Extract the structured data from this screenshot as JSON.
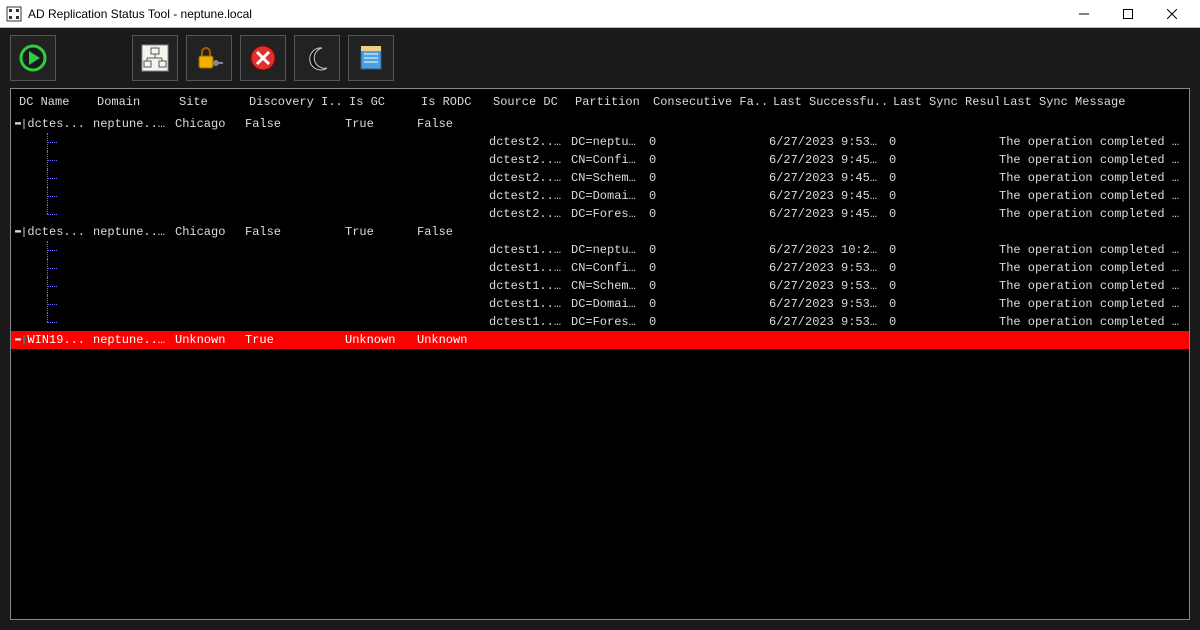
{
  "window": {
    "title": "AD Replication Status Tool - neptune.local",
    "minimize_icon": "minimize",
    "maximize_icon": "maximize",
    "close_icon": "close"
  },
  "toolbar": {
    "refresh_label": "Refresh",
    "forest_label": "Forest View",
    "auth_label": "Credentials",
    "errors_label": "Errors Only",
    "dark_label": "Dark Mode",
    "notes_label": "Notes"
  },
  "columns": {
    "dc_name": "DC Name",
    "domain": "Domain",
    "site": "Site",
    "discovery": "Discovery I...",
    "is_gc": "Is GC",
    "is_rodc": "Is RODC",
    "source_dc": "Source DC",
    "partition": "Partition",
    "consecutive_failures": "Consecutive Fa...",
    "last_success": "Last Successfu...",
    "last_sync_result": "Last Sync Result",
    "last_sync_message": "Last Sync Message"
  },
  "dcs": [
    {
      "dc_name": "dctes...",
      "domain": "neptune....",
      "site": "Chicago",
      "discovery": "False",
      "is_gc": "True",
      "is_rodc": "False",
      "partitions": [
        {
          "source": "dctest2....",
          "partition": "DC=neptu...",
          "failures": "0",
          "last_success": "6/27/2023 9:53:...",
          "result": "0",
          "message": "The operation completed succ..."
        },
        {
          "source": "dctest2....",
          "partition": "CN=Confi...",
          "failures": "0",
          "last_success": "6/27/2023 9:45:...",
          "result": "0",
          "message": "The operation completed succ..."
        },
        {
          "source": "dctest2....",
          "partition": "CN=Schem...",
          "failures": "0",
          "last_success": "6/27/2023 9:45:...",
          "result": "0",
          "message": "The operation completed succ..."
        },
        {
          "source": "dctest2....",
          "partition": "DC=Domai...",
          "failures": "0",
          "last_success": "6/27/2023 9:45:...",
          "result": "0",
          "message": "The operation completed succ..."
        },
        {
          "source": "dctest2....",
          "partition": "DC=Fores...",
          "failures": "0",
          "last_success": "6/27/2023 9:45:...",
          "result": "0",
          "message": "The operation completed succ..."
        }
      ]
    },
    {
      "dc_name": "dctes...",
      "domain": "neptune....",
      "site": "Chicago",
      "discovery": "False",
      "is_gc": "True",
      "is_rodc": "False",
      "partitions": [
        {
          "source": "dctest1....",
          "partition": "DC=neptu...",
          "failures": "0",
          "last_success": "6/27/2023 10:28...",
          "result": "0",
          "message": "The operation completed succ..."
        },
        {
          "source": "dctest1....",
          "partition": "CN=Confi...",
          "failures": "0",
          "last_success": "6/27/2023 9:53:...",
          "result": "0",
          "message": "The operation completed succ..."
        },
        {
          "source": "dctest1....",
          "partition": "CN=Schem...",
          "failures": "0",
          "last_success": "6/27/2023 9:53:...",
          "result": "0",
          "message": "The operation completed succ..."
        },
        {
          "source": "dctest1....",
          "partition": "DC=Domai...",
          "failures": "0",
          "last_success": "6/27/2023 9:53:...",
          "result": "0",
          "message": "The operation completed succ..."
        },
        {
          "source": "dctest1....",
          "partition": "DC=Fores...",
          "failures": "0",
          "last_success": "6/27/2023 9:53:...",
          "result": "0",
          "message": "The operation completed succ..."
        }
      ]
    }
  ],
  "error_dc": {
    "dc_name": "WIN19...",
    "domain": "neptune....",
    "site": "Unknown",
    "discovery": "True",
    "is_gc": "Unknown",
    "is_rodc": "Unknown"
  }
}
